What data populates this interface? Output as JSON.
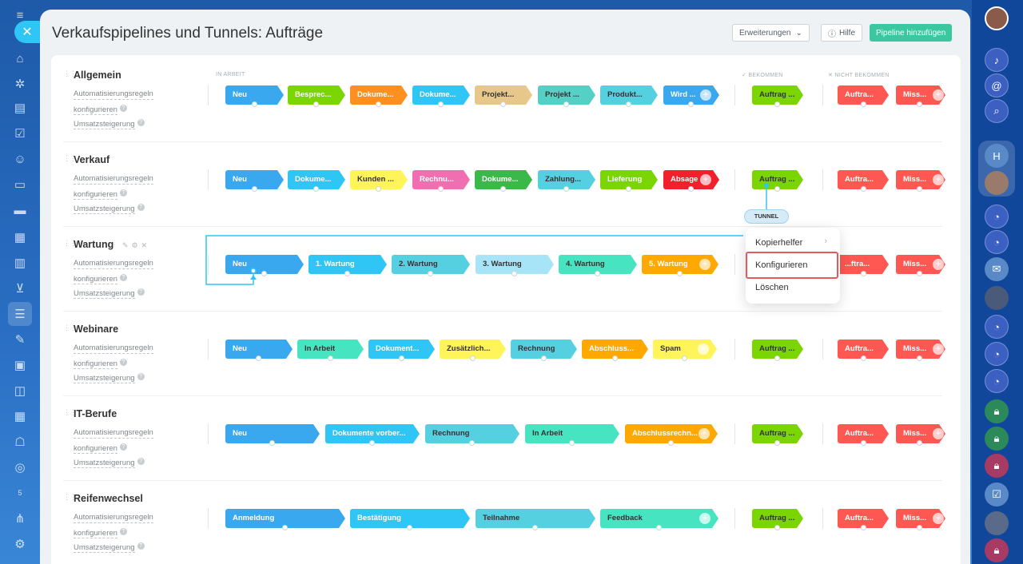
{
  "page": {
    "title": "Verkaufspipelines und Tunnels: Aufträge",
    "extensions_label": "Erweiterungen",
    "help_label": "Hilfe",
    "add_pipeline_label": "Pipeline hinzufügen"
  },
  "columns": {
    "in_progress": "IN ARBEIT",
    "won": "BEKOMMEN",
    "lost": "NICHT BEKOMMEN"
  },
  "row_links": {
    "automation": "Automatisierungsregeln",
    "configure": "konfigurieren",
    "sales_boost": "Umsatzsteigerung"
  },
  "pipelines": [
    {
      "name": "Allgemein",
      "stages": [
        {
          "label": "Neu",
          "color": "#39a8ef"
        },
        {
          "label": "Besprec...",
          "color": "#7bd500"
        },
        {
          "label": "Dokume...",
          "color": "#ff8f1f"
        },
        {
          "label": "Dokume...",
          "color": "#2fc6f6"
        },
        {
          "label": "Projekt...",
          "color": "#e8c78b"
        },
        {
          "label": "Projekt ...",
          "color": "#55d0c4"
        },
        {
          "label": "Produkt...",
          "color": "#55d0e0"
        },
        {
          "label": "Wird ...",
          "color": "#39a8ef"
        }
      ],
      "won": "Auftrag ...",
      "lost": [
        "Auftra...",
        "Miss..."
      ]
    },
    {
      "name": "Verkauf",
      "stages": [
        {
          "label": "Neu",
          "color": "#39a8ef"
        },
        {
          "label": "Dokume...",
          "color": "#2fc6f6"
        },
        {
          "label": "Kunden ...",
          "color": "#fff55a"
        },
        {
          "label": "Rechnu...",
          "color": "#f06fb0"
        },
        {
          "label": "Dokume...",
          "color": "#3ab849"
        },
        {
          "label": "Zahlung...",
          "color": "#55d0e0"
        },
        {
          "label": "Lieferung",
          "color": "#7bd500"
        },
        {
          "label": "Absage",
          "color": "#f0202c"
        }
      ],
      "won": "Auftrag ...",
      "lost": [
        "Auftra...",
        "Miss..."
      ]
    },
    {
      "name": "Wartung",
      "stages": [
        {
          "label": "Neu",
          "color": "#39a8ef"
        },
        {
          "label": "1. Wartung",
          "color": "#2fc6f6"
        },
        {
          "label": "2. Wartung",
          "color": "#55d0e0"
        },
        {
          "label": "3. Wartung",
          "color": "#a8e4f8"
        },
        {
          "label": "4. Wartung",
          "color": "#47e4c2"
        },
        {
          "label": "5. Wartung",
          "color": "#ffa900"
        }
      ],
      "won": "",
      "lost": [
        "...ftra...",
        "Miss..."
      ]
    },
    {
      "name": "Webinare",
      "stages": [
        {
          "label": "Neu",
          "color": "#39a8ef"
        },
        {
          "label": "In Arbeit",
          "color": "#47e4c2"
        },
        {
          "label": "Dokument...",
          "color": "#2fc6f6"
        },
        {
          "label": "Zusätzlich...",
          "color": "#fff55a"
        },
        {
          "label": "Rechnung",
          "color": "#55d0e0"
        },
        {
          "label": "Abschluss...",
          "color": "#ffa900"
        },
        {
          "label": "Spam",
          "color": "#fff55a"
        }
      ],
      "won": "Auftrag ...",
      "lost": [
        "Auftra...",
        "Miss..."
      ]
    },
    {
      "name": "IT-Berufe",
      "stages": [
        {
          "label": "Neu",
          "color": "#39a8ef"
        },
        {
          "label": "Dokumente vorber...",
          "color": "#2fc6f6"
        },
        {
          "label": "Rechnung",
          "color": "#55d0e0"
        },
        {
          "label": "In Arbeit",
          "color": "#47e4c2"
        },
        {
          "label": "Abschlussrechn...",
          "color": "#ffa900"
        }
      ],
      "won": "Auftrag ...",
      "lost": [
        "Auftra...",
        "Miss..."
      ]
    },
    {
      "name": "Reifenwechsel",
      "stages": [
        {
          "label": "Anmeldung",
          "color": "#39a8ef"
        },
        {
          "label": "Bestätigung",
          "color": "#2fc6f6"
        },
        {
          "label": "Teilnahme",
          "color": "#55d0e0"
        },
        {
          "label": "Feedback",
          "color": "#47e4c2"
        }
      ],
      "won": "Auftrag ...",
      "lost": [
        "Auftra...",
        "Miss..."
      ]
    }
  ],
  "tunnel_label": "TUNNEL",
  "context_menu": {
    "items": [
      "Kopierhelfer",
      "Konfigurieren",
      "Löschen"
    ]
  },
  "sidebar_counter": "5",
  "colors": {
    "won": "#7bd500",
    "lost": "#ff5752",
    "accent": "#3bc8a0",
    "tunnel_line": "#2fc6f6"
  }
}
